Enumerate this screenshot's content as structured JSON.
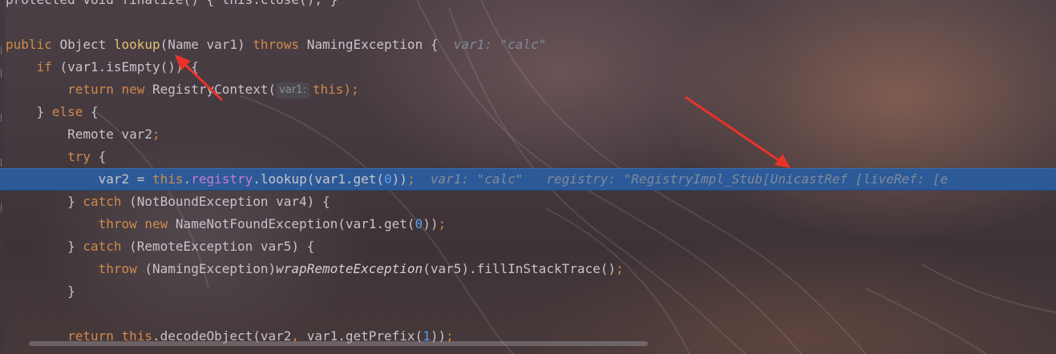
{
  "code_lines": [
    {
      "id": "line-0",
      "tokens": [
        {
          "t": "protected void finalize() { this.close(); }",
          "c": "plain"
        }
      ]
    },
    {
      "id": "line-1",
      "tokens": []
    },
    {
      "id": "line-2",
      "tokens": [
        {
          "t": "public ",
          "c": "kw"
        },
        {
          "t": "Object ",
          "c": "plain"
        },
        {
          "t": "lookup",
          "c": "fn"
        },
        {
          "t": "(Name var1) ",
          "c": "plain"
        },
        {
          "t": "throws ",
          "c": "kw"
        },
        {
          "t": "NamingException {  ",
          "c": "plain"
        },
        {
          "t": "var1: \"calc\"",
          "c": "hint"
        }
      ]
    },
    {
      "id": "line-3",
      "tokens": [
        {
          "t": "    if ",
          "c": "kw"
        },
        {
          "t": "(var1.isEmpty()) {",
          "c": "plain"
        }
      ]
    },
    {
      "id": "line-4",
      "tokens": [
        {
          "t": "        return new ",
          "c": "kw"
        },
        {
          "t": "RegistryContext(",
          "c": "plain"
        },
        {
          "t": "var1:",
          "c": "hintbox"
        },
        {
          "t": "this",
          "c": "kw"
        },
        {
          "t": ");",
          "c": "kw"
        }
      ]
    },
    {
      "id": "line-5",
      "tokens": [
        {
          "t": "    } ",
          "c": "plain"
        },
        {
          "t": "else ",
          "c": "kw"
        },
        {
          "t": "{",
          "c": "plain"
        }
      ]
    },
    {
      "id": "line-6",
      "tokens": [
        {
          "t": "        Remote var2",
          "c": "plain"
        },
        {
          "t": ";",
          "c": "kw"
        }
      ]
    },
    {
      "id": "line-7",
      "tokens": [
        {
          "t": "        try ",
          "c": "kw"
        },
        {
          "t": "{",
          "c": "plain"
        }
      ]
    },
    {
      "id": "line-8",
      "highlight": true,
      "tokens": [
        {
          "t": "            var2 = ",
          "c": "plain"
        },
        {
          "t": "this",
          "c": "kw"
        },
        {
          "t": ".",
          "c": "plain"
        },
        {
          "t": "registry",
          "c": "fld"
        },
        {
          "t": ".lookup(var1.get(",
          "c": "plain"
        },
        {
          "t": "0",
          "c": "num"
        },
        {
          "t": "))",
          "c": "plain"
        },
        {
          "t": ";",
          "c": "kw"
        },
        {
          "t": "  var1: \"calc\"   registry: \"RegistryImpl_Stub[UnicastRef [liveRef: [e",
          "c": "hint"
        }
      ]
    },
    {
      "id": "line-9",
      "tokens": [
        {
          "t": "        } ",
          "c": "plain"
        },
        {
          "t": "catch ",
          "c": "kw"
        },
        {
          "t": "(NotBoundException var4) {",
          "c": "plain"
        }
      ]
    },
    {
      "id": "line-10",
      "tokens": [
        {
          "t": "            throw new ",
          "c": "kw"
        },
        {
          "t": "NameNotFoundException(var1.get(",
          "c": "plain"
        },
        {
          "t": "0",
          "c": "num"
        },
        {
          "t": "))",
          "c": "plain"
        },
        {
          "t": ";",
          "c": "kw"
        }
      ]
    },
    {
      "id": "line-11",
      "tokens": [
        {
          "t": "        } ",
          "c": "plain"
        },
        {
          "t": "catch ",
          "c": "kw"
        },
        {
          "t": "(RemoteException var5) {",
          "c": "plain"
        }
      ]
    },
    {
      "id": "line-12",
      "tokens": [
        {
          "t": "            throw ",
          "c": "kw"
        },
        {
          "t": "(NamingException)",
          "c": "plain"
        },
        {
          "t": "wrapRemoteException",
          "c": "ital"
        },
        {
          "t": "(var5).fillInStackTrace()",
          "c": "plain"
        },
        {
          "t": ";",
          "c": "kw"
        }
      ]
    },
    {
      "id": "line-13",
      "tokens": [
        {
          "t": "        }",
          "c": "plain"
        }
      ]
    },
    {
      "id": "line-14",
      "tokens": []
    },
    {
      "id": "line-15",
      "tokens": [
        {
          "t": "        return ",
          "c": "kw"
        },
        {
          "t": "this",
          "c": "kw"
        },
        {
          "t": ".decodeObject(var2",
          "c": "plain"
        },
        {
          "t": ", ",
          "c": "kw"
        },
        {
          "t": "var1.getPrefix(",
          "c": "plain"
        },
        {
          "t": "1",
          "c": "num"
        },
        {
          "t": "))",
          "c": "plain"
        },
        {
          "t": ";",
          "c": "kw"
        }
      ]
    }
  ],
  "colors": {
    "keyword": "#d08a4a",
    "method_decl": "#e2c275",
    "field": "#c77bc7",
    "number": "#5aa0e6",
    "inline_hint": "#808a99",
    "execution_line": "#2c5a98",
    "annotation_arrow": "#e8332a"
  },
  "icons": {
    "arrow_to_method": "red-arrow-icon",
    "arrow_to_hint": "red-arrow-icon"
  }
}
